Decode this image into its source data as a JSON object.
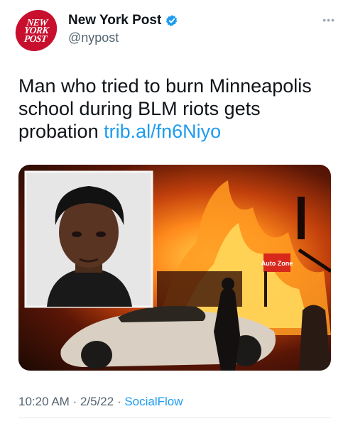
{
  "account": {
    "avatar_lines": [
      "NEW",
      "YORK",
      "POST"
    ],
    "name": "New York Post",
    "handle": "@nypost"
  },
  "tweet": {
    "text": "Man who tried to burn Minneapolis school during BLM riots gets probation ",
    "link": "trib.al/fn6Niyo"
  },
  "media": {
    "sign_text": "Auto Zone"
  },
  "meta": {
    "time": "10:20 AM",
    "date": "2/5/22",
    "source": "SocialFlow"
  },
  "icons": {
    "more": "more-dots-icon",
    "verified": "verified-badge-icon"
  },
  "colors": {
    "brand_red": "#c8102e",
    "link_blue": "#1d9bf0",
    "secondary_text": "#536471"
  }
}
